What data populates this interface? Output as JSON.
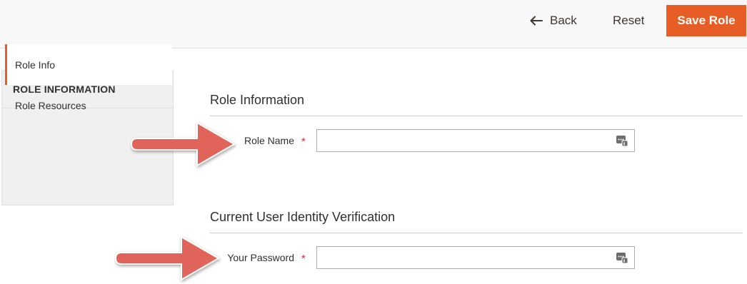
{
  "header": {
    "back_label": "Back",
    "reset_label": "Reset",
    "save_label": "Save Role"
  },
  "sidebar": {
    "title": "ROLE INFORMATION",
    "tabs": [
      {
        "label": "Role Info",
        "active": true
      },
      {
        "label": "Role Resources",
        "active": false
      }
    ]
  },
  "sections": [
    {
      "title": "Role Information",
      "field": {
        "label": "Role Name",
        "required_mark": "*",
        "value": "",
        "icon": "password-manager-icon"
      }
    },
    {
      "title": "Current User Identity Verification",
      "field": {
        "label": "Your Password",
        "required_mark": "*",
        "value": "",
        "icon": "password-manager-icon"
      }
    }
  ],
  "colors": {
    "accent": "#e65e25",
    "annotation_arrow": "#e0645a",
    "required": "#e22626"
  }
}
